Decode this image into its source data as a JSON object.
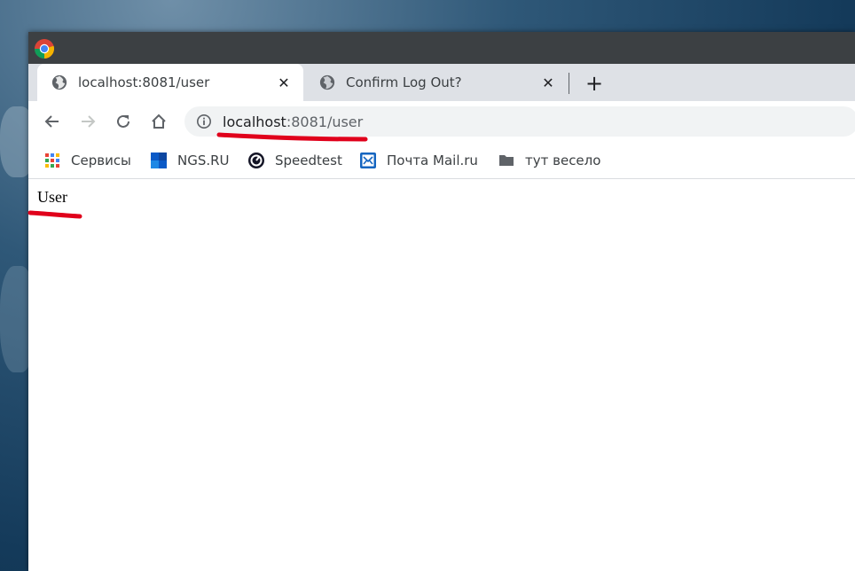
{
  "browser": {
    "tabs": [
      {
        "label": "localhost:8081/user",
        "active": true
      },
      {
        "label": "Confirm Log Out?",
        "active": false
      }
    ],
    "new_tab_label": "+",
    "address": {
      "host": "localhost",
      "rest": ":8081/user"
    },
    "bookmarks": [
      {
        "label": "Сервисы",
        "icon": "apps-grid-icon"
      },
      {
        "label": "NGS.RU",
        "icon": "ngs-logo-icon"
      },
      {
        "label": "Speedtest",
        "icon": "speedtest-icon"
      },
      {
        "label": "Почта Mail.ru",
        "icon": "mail-icon"
      },
      {
        "label": "тут весело",
        "icon": "folder-icon"
      }
    ]
  },
  "page": {
    "heading_text": "User"
  },
  "colors": {
    "annotation_red": "#e0001b",
    "tab_strip": "#dee1e6",
    "title_bar": "#3c4043"
  }
}
